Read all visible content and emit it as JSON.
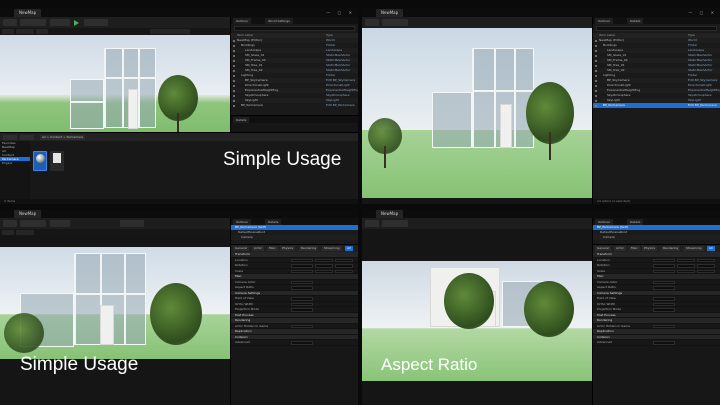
{
  "window": {
    "tab_label": "NewMap",
    "controls": "— ▢ ✕"
  },
  "panels": {
    "outliner_tab": "Outliner",
    "details_tab": "Details",
    "world_tab": "World Settings"
  },
  "outliner": {
    "col_label": "Item Label",
    "col_type": "Type",
    "rows": [
      {
        "name": "NewMap (Editor)",
        "type": "World"
      },
      {
        "name": "Buildings",
        "type": "Folder"
      },
      {
        "name": "Landscape",
        "type": "Landscape"
      },
      {
        "name": "SM_Glass_01",
        "type": "StaticMeshActor"
      },
      {
        "name": "SM_Frame_02",
        "type": "StaticMeshActor"
      },
      {
        "name": "SM_Tree_01",
        "type": "StaticMeshActor"
      },
      {
        "name": "SM_Tree_02",
        "type": "StaticMeshActor"
      },
      {
        "name": "Lighting",
        "type": "Folder"
      },
      {
        "name": "BP_SkyCamera",
        "type": "Edit BP_SkyCamera"
      },
      {
        "name": "DirectionalLight",
        "type": "DirectionalLight"
      },
      {
        "name": "ExponentialHeightFog",
        "type": "ExponentialHeightFog"
      },
      {
        "name": "SkyAtmosphere",
        "type": "SkyAtmosphere"
      },
      {
        "name": "SkyLight",
        "type": "SkyLight"
      },
      {
        "name": "BP_ParCamera",
        "type": "Edit BP_ParCamera"
      }
    ],
    "actor_count": "14 actors (1 selected)"
  },
  "content_browser": {
    "path": "All > Content > ParCamera",
    "tree": [
      "Favorites",
      "NewMap",
      "All",
      "Content",
      "ParCamera",
      "Engine"
    ],
    "status": "2 items"
  },
  "details": {
    "actor_name": "BP_ParCamera",
    "components": [
      "BP_ParCamera (Self)",
      "DefaultSceneRoot",
      "Camera"
    ],
    "filters": [
      "General",
      "Actor",
      "Misc",
      "Physics",
      "Rendering",
      "Streaming",
      "All"
    ],
    "properties": [
      {
        "label": "Transform",
        "cat": true
      },
      {
        "label": "Location",
        "cat": false
      },
      {
        "label": "Rotation",
        "cat": false
      },
      {
        "label": "Scale",
        "cat": false
      },
      {
        "label": "Misc",
        "cat": true
      },
      {
        "label": "Camera Actor",
        "cat": false
      },
      {
        "label": "Aspect Ratio",
        "cat": false
      },
      {
        "label": "Camera Settings",
        "cat": true
      },
      {
        "label": "Field of View",
        "cat": false
      },
      {
        "label": "Ortho Width",
        "cat": false
      },
      {
        "label": "Projection Mode",
        "cat": false
      },
      {
        "label": "Post Process",
        "cat": true
      },
      {
        "label": "Rendering",
        "cat": true
      },
      {
        "label": "Actor Hidden In Game",
        "cat": false
      },
      {
        "label": "Replication",
        "cat": true
      },
      {
        "label": "Collision",
        "cat": true
      },
      {
        "label": "Advanced",
        "cat": false
      }
    ]
  },
  "captions": {
    "q1": "Simple Usage",
    "q3": "Simple Usage",
    "q4": "Aspect Ratio"
  }
}
